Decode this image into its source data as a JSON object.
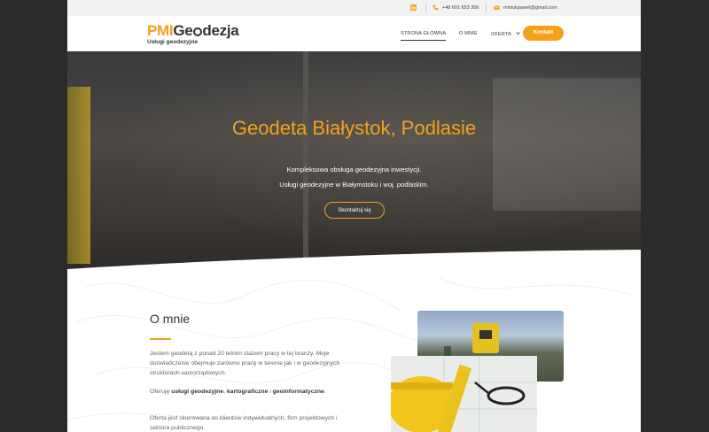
{
  "topbar": {
    "linkedin_icon": "linkedin-icon",
    "phone": "+48 601 653 306",
    "phone_icon": "phone-icon",
    "email": "miniukpawel@gmail.com",
    "email_icon": "envelope-icon"
  },
  "logo": {
    "part1": "PMI",
    "part2a": "Ge",
    "part2b": "dezja",
    "tagline": "Usługi geodezyjne"
  },
  "nav": {
    "items": [
      {
        "label": "STRONA GŁÓWNA"
      },
      {
        "label": "O MNIE"
      },
      {
        "label": "OFERTA"
      }
    ],
    "cta": "Kontakt"
  },
  "hero": {
    "title": "Geodeta Białystok, Podlasie",
    "line1": "Kompleksowa obsługa geodezyjna inwestycji.",
    "line2": "Usługi geodezyjne w Białymstoku i woj. podlaskim.",
    "button": "Skontaktuj się"
  },
  "about": {
    "heading": "O mnie",
    "p1": "Jestem geodetą z ponad 20 letnim stażem pracy w tej branży. Moje doświadczenie obejmuje zarówno pracę w terenie jak i w geodezyjnych strukturach samorządowych.",
    "p2_prefix": "Oferuję ",
    "p2_b1": "usługi geodezyjne",
    "p2_mid": ", ",
    "p2_b2": "kartograficzne",
    "p2_and": " i ",
    "p2_b3": "geoinformatyczne",
    "p2_end": ".",
    "p3": "Oferta jest skierowana do klientów indywidualnych, firm projektowych i sektora publicznego."
  },
  "colors": {
    "accent": "#f4a11a",
    "text_dark": "#333333",
    "text_body": "#666666"
  }
}
